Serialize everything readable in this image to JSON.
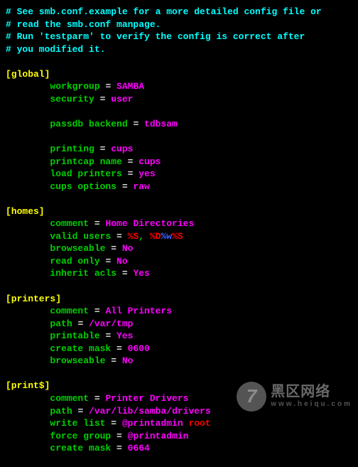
{
  "comments": [
    "# See smb.conf.example for a more detailed config file or",
    "# read the smb.conf manpage.",
    "# Run 'testparm' to verify the config is correct after",
    "# you modified it."
  ],
  "sections": [
    {
      "header": "[global]",
      "entries": [
        {
          "key": "workgroup",
          "value": "SAMBA",
          "class": "magenta"
        },
        {
          "key": "security",
          "value": "user",
          "class": "magenta"
        },
        null,
        {
          "key": "passdb backend",
          "value": "tdbsam",
          "class": "magenta"
        },
        null,
        {
          "key": "printing",
          "value": "cups",
          "class": "magenta"
        },
        {
          "key": "printcap name",
          "value": "cups",
          "class": "magenta"
        },
        {
          "key": "load printers",
          "value": "yes",
          "class": "magenta"
        },
        {
          "key": "cups options",
          "value": "raw",
          "class": "magenta"
        }
      ]
    },
    {
      "header": "[homes]",
      "entries": [
        {
          "key": "comment",
          "value": "Home Directories",
          "class": "magenta"
        },
        {
          "raw_key": "valid users",
          "raw_segments": [
            {
              "t": "%S",
              "c": "red"
            },
            {
              "t": ", ",
              "c": "green"
            },
            {
              "t": "%D",
              "c": "red"
            },
            {
              "t": "%w",
              "c": "blue"
            },
            {
              "t": "%S",
              "c": "red"
            }
          ]
        },
        {
          "key": "browseable",
          "value": "No",
          "class": "magenta"
        },
        {
          "key": "read only",
          "value": "No",
          "class": "magenta"
        },
        {
          "key": "inherit acls",
          "value": "Yes",
          "class": "magenta"
        }
      ]
    },
    {
      "header": "[printers]",
      "entries": [
        {
          "key": "comment",
          "value": "All Printers",
          "class": "magenta"
        },
        {
          "key": "path",
          "value": "/var/tmp",
          "class": "magenta"
        },
        {
          "key": "printable",
          "value": "Yes",
          "class": "magenta"
        },
        {
          "key": "create mask",
          "value": "0600",
          "class": "magenta"
        },
        {
          "key": "browseable",
          "value": "No",
          "class": "magenta"
        }
      ]
    },
    {
      "header": "[print$]",
      "entries": [
        {
          "key": "comment",
          "value": "Printer Drivers",
          "class": "magenta"
        },
        {
          "key": "path",
          "value": "/var/lib/samba/drivers",
          "class": "magenta"
        },
        {
          "raw_key": "write list",
          "raw_segments": [
            {
              "t": "@printadmin",
              "c": "magenta"
            },
            {
              "t": " root",
              "c": "red"
            }
          ]
        },
        {
          "key": "force group",
          "value": "@printadmin",
          "class": "magenta"
        },
        {
          "key": "create mask",
          "value": "0664",
          "class": "magenta"
        }
      ]
    }
  ],
  "indent": "        ",
  "eq": " = ",
  "watermark": {
    "glyph": "7",
    "line1": "黑区网络",
    "line2": "www.heiqu.com"
  }
}
